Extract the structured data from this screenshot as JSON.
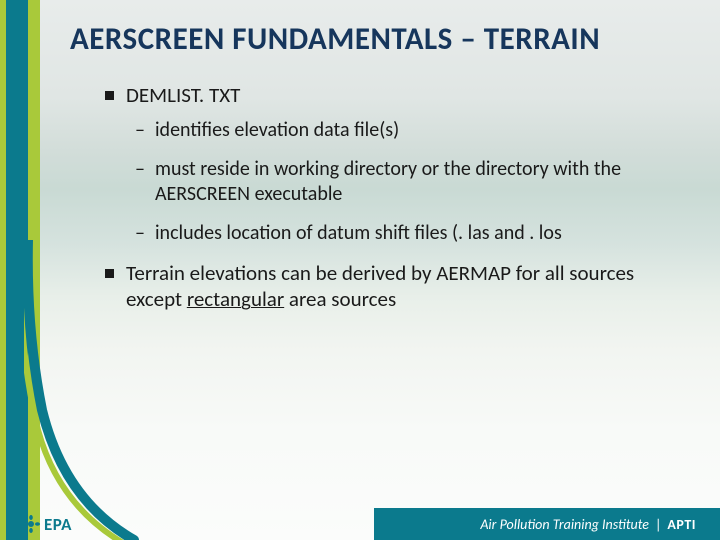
{
  "title": "AERSCREEN FUNDAMENTALS – TERRAIN",
  "bullets": {
    "0": {
      "text": "DEMLIST. TXT"
    },
    "1": {
      "text": "identifies elevation data file(s)"
    },
    "2": {
      "text": "must reside in working directory or the directory with the AERSCREEN executable"
    },
    "3": {
      "text": "includes location of datum shift files (. las and . los"
    },
    "4": {
      "prefix": "Terrain elevations can be derived by AERMAP for all sources except ",
      "underlined": "rectangular",
      "suffix": " area sources"
    }
  },
  "footer": {
    "epa": "EPA",
    "institute": "Air Pollution Training Institute",
    "pipe": "|",
    "apti": "APTI"
  }
}
